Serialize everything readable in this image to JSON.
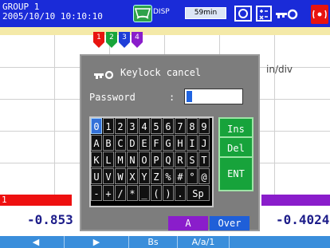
{
  "header": {
    "group": "GROUP 1",
    "datetime": "2005/10/10 10:10:10",
    "disp_label": "DISP",
    "time_div": "59min"
  },
  "channels": {
    "marker_labels": [
      "1",
      "2",
      "3",
      "4"
    ],
    "marker_colors": [
      "#e8140f",
      "#18a53a",
      "#1f3fd8",
      "#8a1dcb"
    ],
    "units_text": "in/div",
    "ch1_tag": "1",
    "ch1_value": "-0.853",
    "ch4_value": "-0.4024"
  },
  "dialog": {
    "title": "Keylock cancel",
    "password_label": "Password",
    "password_colon": ":",
    "keys": [
      [
        "0",
        "1",
        "2",
        "3",
        "4",
        "5",
        "6",
        "7",
        "8",
        "9"
      ],
      [
        "A",
        "B",
        "C",
        "D",
        "E",
        "F",
        "G",
        "H",
        "I",
        "J"
      ],
      [
        "K",
        "L",
        "M",
        "N",
        "O",
        "P",
        "Q",
        "R",
        "S",
        "T"
      ],
      [
        "U",
        "V",
        "W",
        "X",
        "Y",
        "Z",
        "%",
        "#",
        "°",
        "@"
      ],
      [
        "-",
        "+",
        "/",
        "*",
        "_",
        "(",
        ")",
        ".",
        "Sp",
        ""
      ]
    ],
    "fkeys": [
      "Ins",
      "Del",
      "ENT"
    ],
    "mode_labels": [
      "A",
      "Over"
    ]
  },
  "softkeys": [
    "◀",
    "▶",
    "Bs",
    "A/a/1"
  ],
  "colors": {
    "topbar": "#1a2bd8",
    "dialog_bg": "#7d7d7d",
    "fkey": "#17a33b",
    "alarm": "#e8140f"
  },
  "icons": [
    "disp-icon",
    "record-icon",
    "math-icon",
    "key-icon",
    "alarm-icon"
  ]
}
